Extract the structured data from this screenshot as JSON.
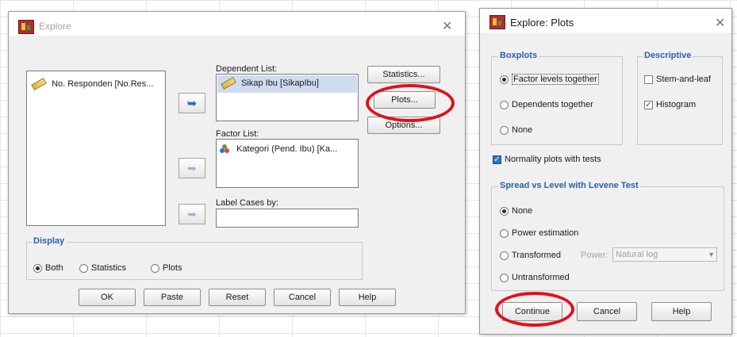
{
  "explore": {
    "title": "Explore",
    "source_vars": [
      {
        "label": "No. Responden [No.Res...",
        "icon": "scale-ruler-icon"
      }
    ],
    "dependent_list": {
      "label": "Dependent List:",
      "items": [
        {
          "label": "Sikap Ibu [SikapIbu]",
          "icon": "scale-ruler-icon"
        }
      ]
    },
    "factor_list": {
      "label": "Factor List:",
      "items": [
        {
          "label": "Kategori (Pend. Ibu) [Ka...",
          "icon": "nominal-icon"
        }
      ]
    },
    "label_cases": {
      "label": "Label Cases by:",
      "value": ""
    },
    "buttons": {
      "statistics": "Statistics...",
      "plots": "Plots...",
      "options": "Options..."
    },
    "display": {
      "title": "Display",
      "options": [
        "Both",
        "Statistics",
        "Plots"
      ],
      "selected": "Both"
    },
    "footer_buttons": {
      "ok": "OK",
      "paste": "Paste",
      "reset": "Reset",
      "cancel": "Cancel",
      "help": "Help"
    }
  },
  "plots": {
    "title": "Explore: Plots",
    "boxplots": {
      "title": "Boxplots",
      "options": [
        "Factor levels together",
        "Dependents together",
        "None"
      ],
      "selected": "Factor levels together"
    },
    "descriptive": {
      "title": "Descriptive",
      "stem_and_leaf": {
        "label": "Stem-and-leaf",
        "checked": false
      },
      "histogram": {
        "label": "Histogram",
        "checked": true
      }
    },
    "normality": {
      "label": "Normality plots with tests",
      "checked": true
    },
    "spread": {
      "title": "Spread vs Level with Levene Test",
      "options": [
        "None",
        "Power estimation",
        "Transformed",
        "Untransformed"
      ],
      "selected": "None",
      "power_label": "Power:",
      "power_value": "Natural log"
    },
    "footer_buttons": {
      "continue": "Continue",
      "cancel": "Cancel",
      "help": "Help"
    }
  },
  "colors": {
    "highlight_ring": "#e0111a",
    "group_title": "#2c5fa8"
  }
}
